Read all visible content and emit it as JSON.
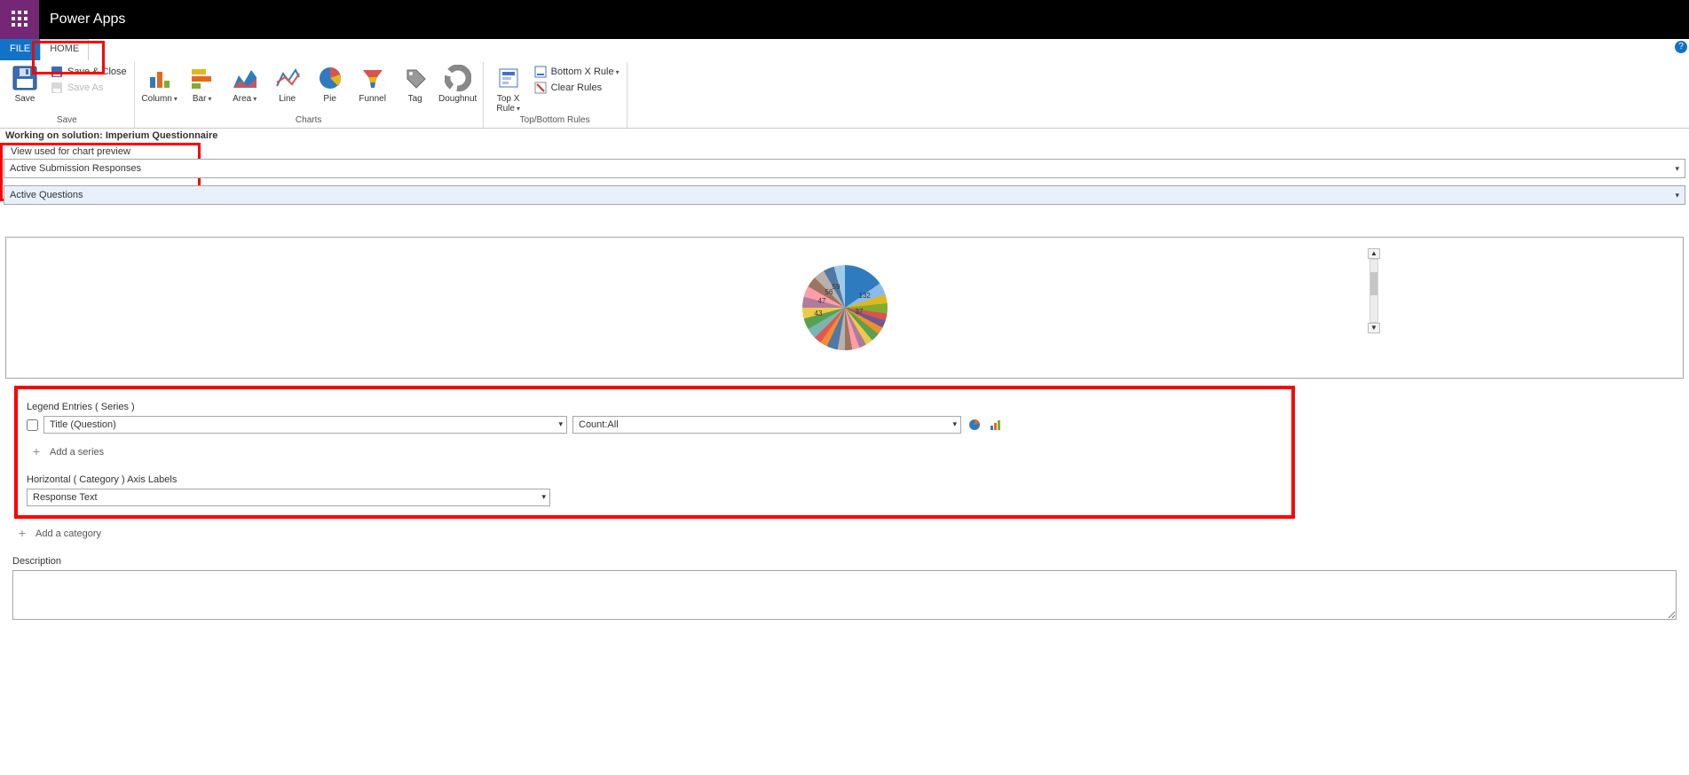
{
  "header": {
    "app_title": "Power Apps"
  },
  "tabs": {
    "file": "FILE",
    "home": "HOME"
  },
  "ribbon": {
    "save": {
      "save": "Save",
      "save_close": "Save & Close",
      "save_as": "Save As",
      "group_label": "Save"
    },
    "charts": {
      "column": "Column",
      "bar": "Bar",
      "area": "Area",
      "line": "Line",
      "pie": "Pie",
      "funnel": "Funnel",
      "tag": "Tag",
      "doughnut": "Doughnut",
      "group_label": "Charts"
    },
    "rules": {
      "topx": "Top X Rule",
      "bottomx": "Bottom X Rule",
      "clear": "Clear Rules",
      "group_label": "Top/Bottom Rules"
    }
  },
  "solution": {
    "prefix": "Working on solution:",
    "name": "Imperium Questionnaire"
  },
  "view": {
    "label": "View used for chart preview",
    "selected": "Active Submission Responses",
    "option2": "Active Questions"
  },
  "chart_data": {
    "type": "pie",
    "title": "",
    "series_name": "Title (Question)",
    "aggregate": "Count:All",
    "category_field": "Response Text",
    "visible_labels": [
      "132",
      "37",
      "43",
      "47",
      "56",
      "59"
    ],
    "note": "Many thin multicolored slices; only a few slice values are legible in the preview."
  },
  "legend": {
    "section": "Legend Entries ( Series )",
    "series_field": "Title (Question)",
    "aggregate_field": "Count:All",
    "add_series": "Add a series"
  },
  "axis": {
    "section": "Horizontal ( Category ) Axis Labels",
    "category_field": "Response Text",
    "add_category": "Add a category"
  },
  "description": {
    "label": "Description",
    "value": ""
  }
}
